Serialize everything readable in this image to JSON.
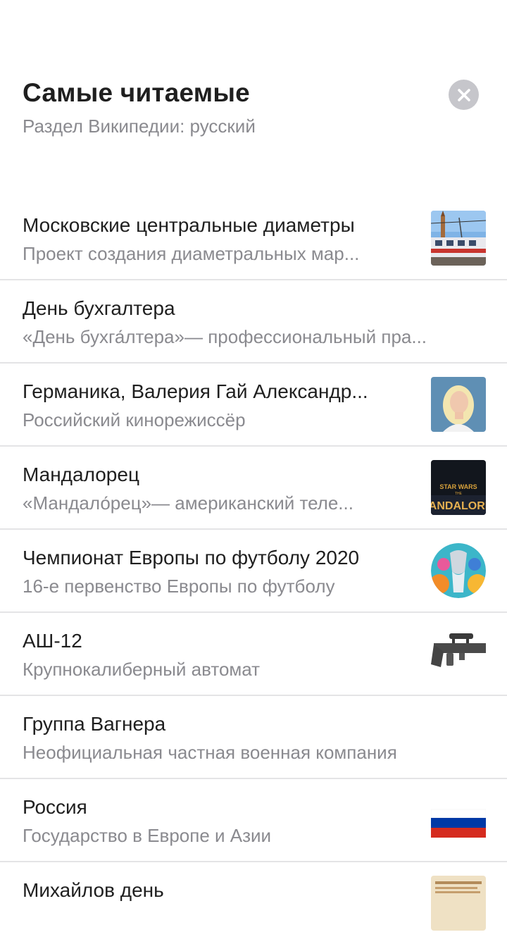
{
  "header": {
    "title": "Самые читаемые",
    "subtitle": "Раздел Википедии: русский",
    "close_icon": "close-icon"
  },
  "articles": [
    {
      "title": "Московские центральные диаметры",
      "description": "Проект создания диаметральных мар...",
      "thumbnail": "train-photo"
    },
    {
      "title": "День бухгалтера",
      "description": "«День бухга́лтера»— профессиональный пра...",
      "thumbnail": null
    },
    {
      "title": "Германика, Валерия Гай Александр...",
      "description": "Российский кинорежиссёр",
      "thumbnail": "portrait-photo"
    },
    {
      "title": "Мандалорец",
      "description": "«Мандало́рец»— американский теле...",
      "thumbnail": "mandalorian-poster",
      "thumbnail_text": [
        "STAR WARS",
        "THE",
        "ANDALORI"
      ]
    },
    {
      "title": "Чемпионат Европы по футболу 2020",
      "description": "16-е первенство Европы по футболу",
      "thumbnail": "euro-2020-logo"
    },
    {
      "title": "АШ-12",
      "description": "Крупнокалиберный автомат",
      "thumbnail": "rifle-photo"
    },
    {
      "title": "Группа Вагнера",
      "description": "Неофициальная частная военная компания",
      "thumbnail": null
    },
    {
      "title": "Россия",
      "description": "Государство в Европе и Азии",
      "thumbnail": "russia-flag"
    },
    {
      "title": "Михайлов день",
      "description": "",
      "thumbnail": "manuscript-image"
    }
  ]
}
